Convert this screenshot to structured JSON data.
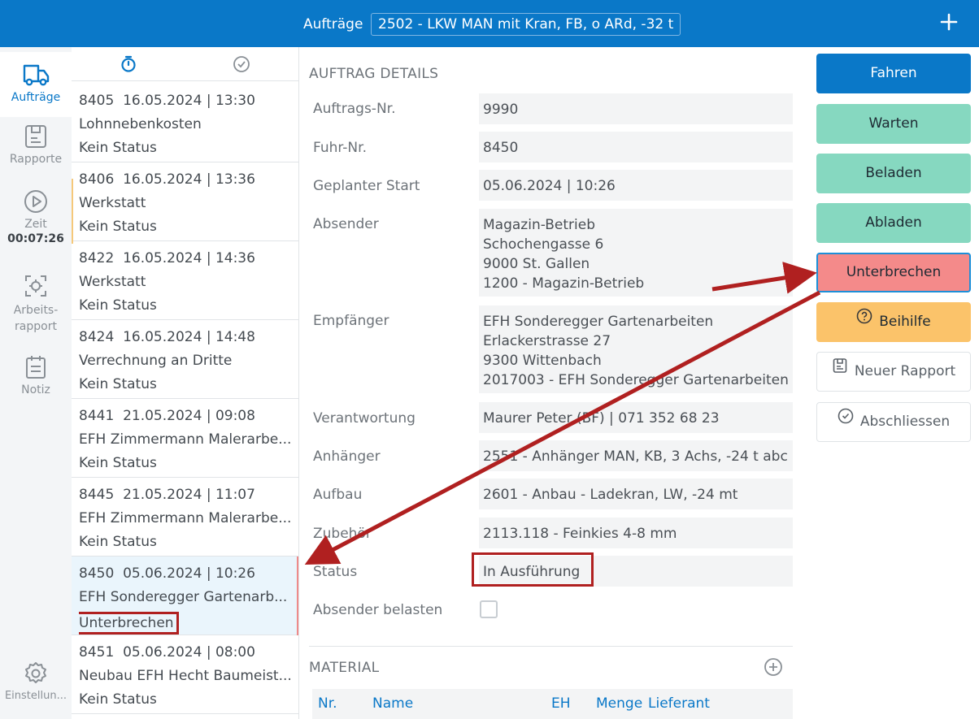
{
  "header": {
    "title": "Aufträge",
    "vehicle": "2502 - LKW MAN mit Kran, FB, o ARd, -32 t",
    "add_icon": "plus-icon"
  },
  "nav": {
    "items": [
      {
        "label": "Aufträge",
        "icon": "truck-icon",
        "active": true
      },
      {
        "label": "Rapporte",
        "icon": "report-icon"
      },
      {
        "label": "Zeit",
        "icon": "play-icon",
        "timer": "00:07:26"
      },
      {
        "label": "Arbeits-\nrapport",
        "icon": "work-report-icon"
      },
      {
        "label": "Notiz",
        "icon": "note-icon"
      },
      {
        "label": "Einstellun...",
        "icon": "settings-icon"
      }
    ]
  },
  "orders": [
    {
      "id": "8405",
      "datetime": "16.05.2024 | 13:30",
      "name": "Lohnnebenkosten",
      "status": "Kein Status"
    },
    {
      "id": "8406",
      "datetime": "16.05.2024 | 13:36",
      "name": "Werkstatt",
      "status": "Kein Status"
    },
    {
      "id": "8422",
      "datetime": "16.05.2024 | 14:36",
      "name": "Werkstatt",
      "status": "Kein Status"
    },
    {
      "id": "8424",
      "datetime": "16.05.2024 | 14:48",
      "name": "Verrechnung an Dritte",
      "status": "Kein Status"
    },
    {
      "id": "8441",
      "datetime": "21.05.2024 | 09:08",
      "name": "EFH Zimmermann Malerarbe...",
      "status": "Kein Status"
    },
    {
      "id": "8445",
      "datetime": "21.05.2024 | 11:07",
      "name": "EFH Zimmermann Malerarbe...",
      "status": "Kein Status"
    },
    {
      "id": "8450",
      "datetime": "05.06.2024 | 10:26",
      "name": "EFH Sonderegger Gartenarb...",
      "status": "Unterbrechen"
    },
    {
      "id": "8451",
      "datetime": "05.06.2024 | 08:00",
      "name": "Neubau EFH Hecht Baumeist...",
      "status": "Kein Status"
    }
  ],
  "details": {
    "section_title": "AUFTRAG DETAILS",
    "rows": [
      {
        "label": "Auftrags-Nr.",
        "value": "9990"
      },
      {
        "label": "Fuhr-Nr.",
        "value": "8450"
      },
      {
        "label": "Geplanter Start",
        "value": "05.06.2024 | 10:26"
      },
      {
        "label": "Absender",
        "value": "Magazin-Betrieb\nSchochengasse 6\n9000 St. Gallen\n1200 - Magazin-Betrieb"
      },
      {
        "label": "Empfänger",
        "value": "EFH Sonderegger Gartenarbeiten\nErlackerstrasse 27\n9300 Wittenbach\n2017003 - EFH Sonderegger Gartenarbeiten"
      },
      {
        "label": "Verantwortung",
        "value": "Maurer Peter (BF) | 071 352 68 23"
      },
      {
        "label": "Anhänger",
        "value": "2551 - Anhänger MAN, KB, 3 Achs, -24 t abc"
      },
      {
        "label": "Aufbau",
        "value": "2601 - Anbau - Ladekran, LW, -24 mt"
      },
      {
        "label": "Zubehör",
        "value": "2113.118 - Feinkies 4-8 mm"
      },
      {
        "label": "Status",
        "value": "In Ausführung"
      }
    ],
    "absender_belasten_label": "Absender belasten",
    "material_title": "MATERIAL",
    "material_columns": [
      "Nr.",
      "Name",
      "EH",
      "Menge",
      "Lieferant"
    ]
  },
  "actions": {
    "fahren": "Fahren",
    "warten": "Warten",
    "beladen": "Beladen",
    "abladen": "Abladen",
    "unterbrechen": "Unterbrechen",
    "beihilfe": "Beihilfe",
    "neuer_rapport": "Neuer Rapport",
    "abschliessen": "Abschliessen"
  },
  "colors": {
    "primary": "#0a78c8",
    "mint": "#86d8c0",
    "red": "#f48a8a",
    "yellow": "#fbc36a",
    "annotation": "#b02020"
  }
}
